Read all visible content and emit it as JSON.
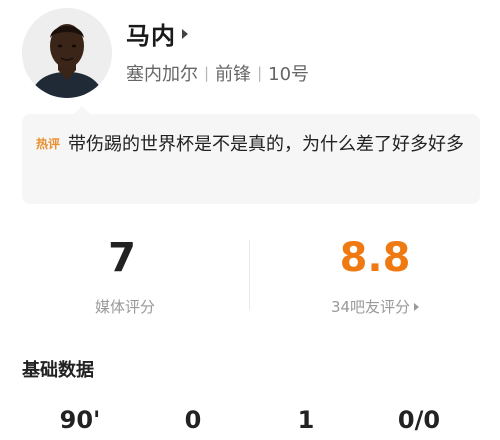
{
  "player": {
    "name": "马内",
    "country": "塞内加尔",
    "position": "前锋",
    "number": "10号",
    "separator": "|"
  },
  "hot_comment": {
    "tag": "热评",
    "text": "带伤踢的世界杯是不是真的，为什么差了好多好多"
  },
  "ratings": {
    "media_score": "7",
    "media_label": "媒体评分",
    "fan_score": "8.8",
    "fan_label": "34吧友评分",
    "fan_color": "#f07a12"
  },
  "basic_stats": {
    "title": "基础数据",
    "values": [
      "90'",
      "0",
      "1",
      "0/0"
    ]
  }
}
